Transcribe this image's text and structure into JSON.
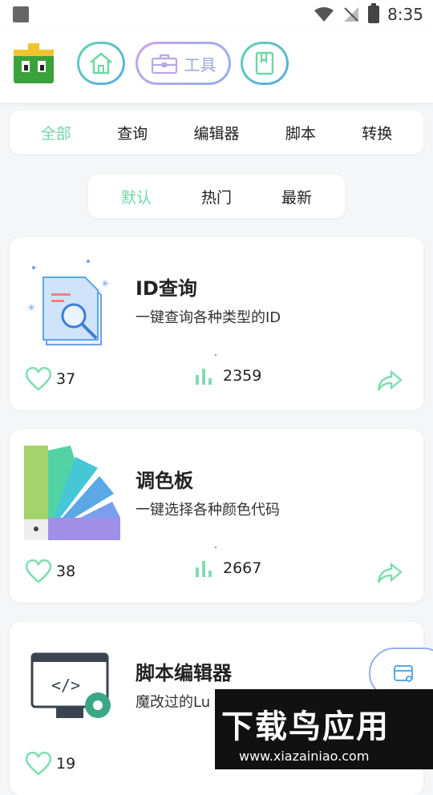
{
  "status": {
    "time": "8:35"
  },
  "nav": {
    "tools_label": "工具"
  },
  "categories": [
    "全部",
    "查询",
    "编辑器",
    "脚本",
    "转换"
  ],
  "sort": [
    "默认",
    "热门",
    "最新"
  ],
  "cards": [
    {
      "title": "ID查询",
      "desc": "一键查询各种类型的ID",
      "likes": "37",
      "views": "2359"
    },
    {
      "title": "调色板",
      "desc": "一键选择各种颜色代码",
      "likes": "38",
      "views": "2667"
    },
    {
      "title": "脚本编辑器",
      "desc": "魔改过的Lu",
      "likes": "19",
      "views": ""
    }
  ],
  "watermark": {
    "big": "下载鸟应用",
    "small": "www.xiazainiao.com"
  },
  "colors": {
    "accent": "#6fd6a5",
    "blue": "#5aa8e6",
    "purple": "#c9a3ea"
  }
}
